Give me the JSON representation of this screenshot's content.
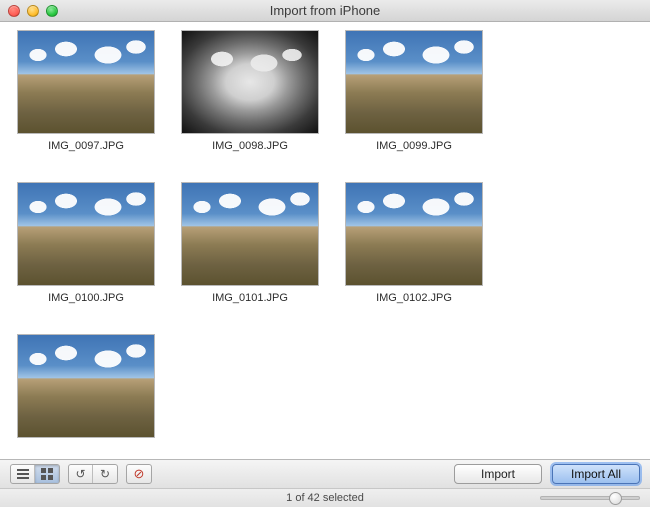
{
  "window": {
    "title": "Import from  iPhone"
  },
  "items": [
    {
      "filename": "IMG_0097.JPG",
      "style": "landscape"
    },
    {
      "filename": "IMG_0098.JPG",
      "style": "bw"
    },
    {
      "filename": "IMG_0099.JPG",
      "style": "landscape"
    },
    {
      "filename": "IMG_0100.JPG",
      "style": "landscape"
    },
    {
      "filename": "IMG_0101.JPG",
      "style": "landscape"
    },
    {
      "filename": "IMG_0102.JPG",
      "style": "landscape"
    },
    {
      "filename": "",
      "style": "landscape"
    }
  ],
  "toolbar": {
    "view_mode": "grid",
    "import_label": "Import",
    "import_all_label": "Import All"
  },
  "status": {
    "text": "1 of 42 selected",
    "zoom_percent": 77
  }
}
